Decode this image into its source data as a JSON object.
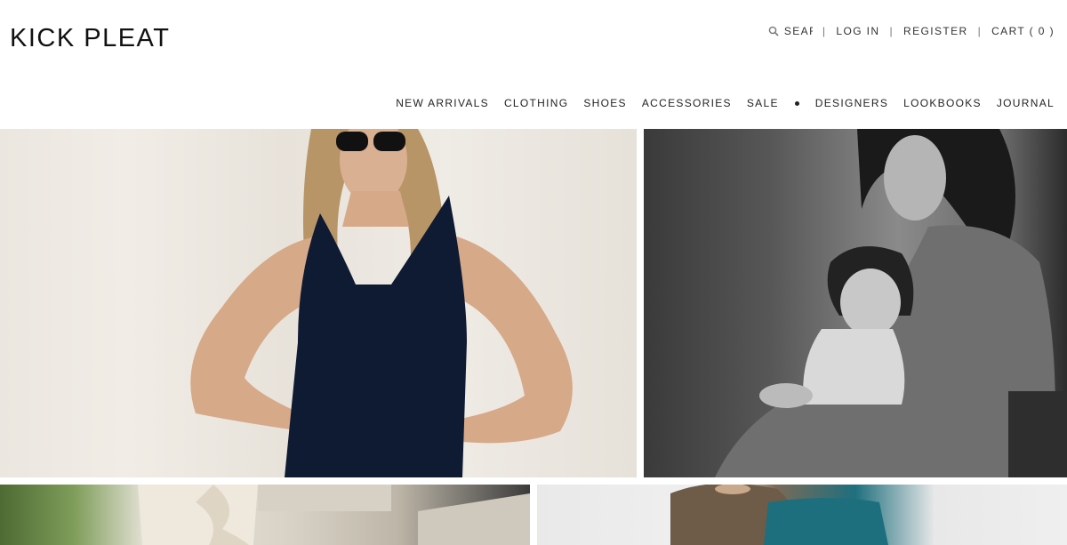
{
  "brand": {
    "logo_text": "KICK PLEAT"
  },
  "utility_nav": {
    "search_placeholder": "SEARCH",
    "login_label": "LOG IN",
    "register_label": "REGISTER",
    "cart_label": "CART ( 0 )",
    "separator": "|"
  },
  "main_nav": {
    "items": [
      {
        "label": "NEW ARRIVALS"
      },
      {
        "label": "CLOTHING"
      },
      {
        "label": "SHOES"
      },
      {
        "label": "ACCESSORIES"
      },
      {
        "label": "SALE"
      },
      {
        "label": "DESIGNERS"
      },
      {
        "label": "LOOKBOOKS"
      },
      {
        "label": "JOURNAL"
      }
    ]
  },
  "icons": {
    "search": "search-icon",
    "nav_divider": "bullet-dot"
  },
  "colors": {
    "text": "#1a1a1a",
    "background": "#ffffff"
  }
}
